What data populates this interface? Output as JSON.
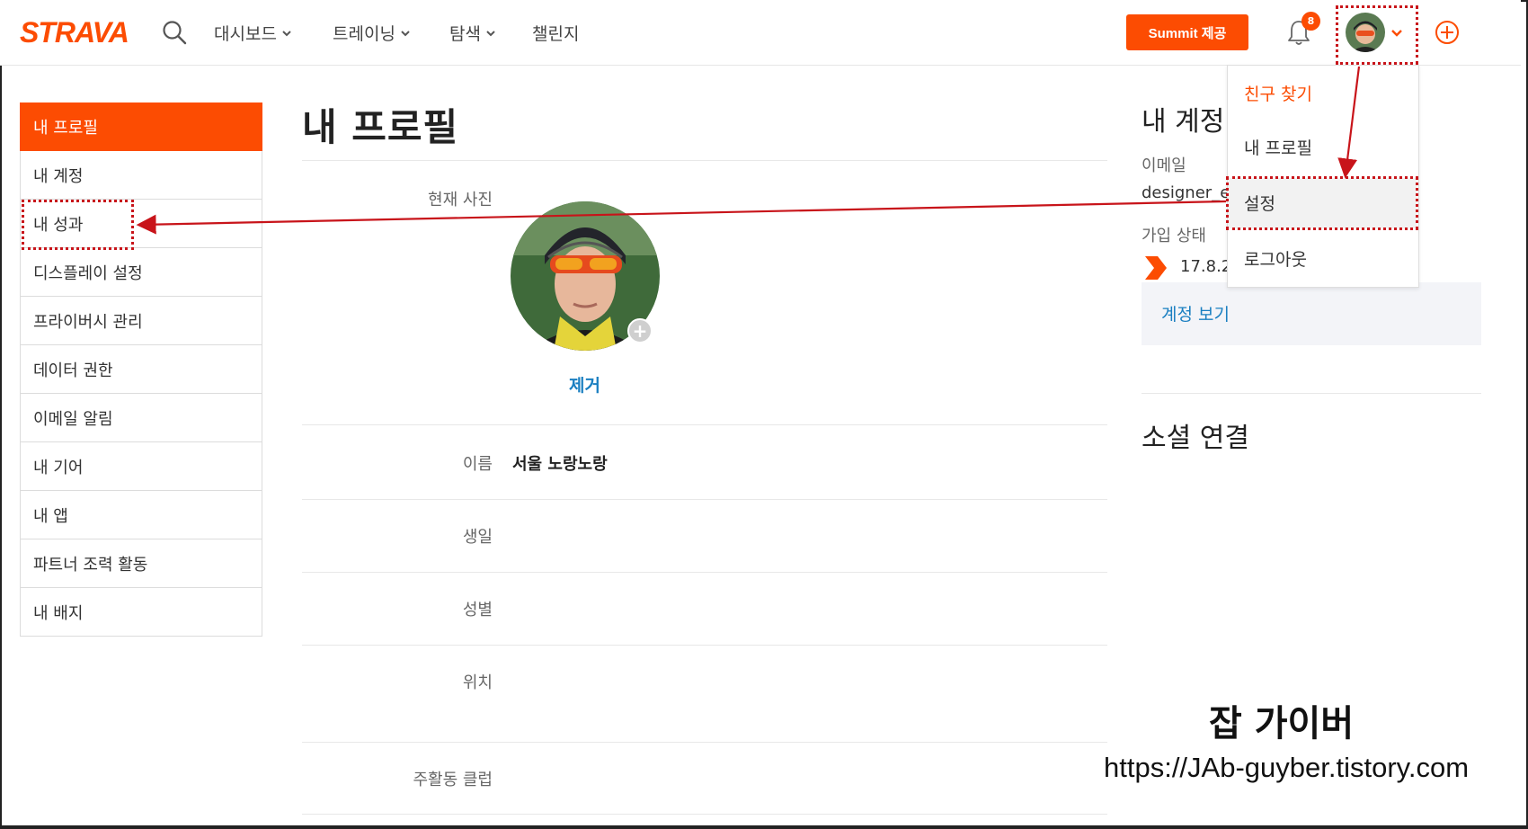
{
  "header": {
    "logo": "STRAVA",
    "nav": [
      {
        "label": "대시보드",
        "has_chevron": true
      },
      {
        "label": "트레이닝",
        "has_chevron": true
      },
      {
        "label": "탐색",
        "has_chevron": true
      },
      {
        "label": "챌린지",
        "has_chevron": false
      }
    ],
    "summit_label": "Summit 제공",
    "notification_count": "8",
    "icons": [
      "search-icon",
      "bell-icon",
      "avatar",
      "chevron-down-icon",
      "plus-circle-icon"
    ]
  },
  "sidebar": {
    "items": [
      {
        "label": "내 프로필",
        "active": true
      },
      {
        "label": "내 계정"
      },
      {
        "label": "내 성과"
      },
      {
        "label": "디스플레이 설정"
      },
      {
        "label": "프라이버시 관리"
      },
      {
        "label": "데이터 권한"
      },
      {
        "label": "이메일 알림"
      },
      {
        "label": "내 기어"
      },
      {
        "label": "내 앱"
      },
      {
        "label": "파트너 조력 활동"
      },
      {
        "label": "내 배지"
      }
    ]
  },
  "main": {
    "title": "내 프로필",
    "photo_label": "현재 사진",
    "remove_label": "제거",
    "fields": [
      {
        "label": "이름",
        "value": "서울 노랑노랑"
      },
      {
        "label": "생일",
        "value": ""
      },
      {
        "label": "성별",
        "value": ""
      },
      {
        "label": "위치",
        "value": ""
      },
      {
        "label": "주활동 클럽",
        "value": ""
      }
    ]
  },
  "right": {
    "account_title": "내 계정",
    "email_label": "이메일",
    "email_value": "designer_e",
    "join_label": "가입 상태",
    "join_date": "17.8.2",
    "account_link": "계정 보기",
    "social_title": "소셜 연결"
  },
  "dropdown": {
    "items": [
      "친구 찾기",
      "내 프로필",
      "설정",
      "로그아웃"
    ],
    "highlighted": "설정"
  },
  "watermark": {
    "title": "잡 가이버",
    "url": "https://JAb-guyber.tistory.com"
  },
  "colors": {
    "brand": "#fc4c02",
    "link": "#1a7fc1",
    "annotation": "#c8141a"
  }
}
